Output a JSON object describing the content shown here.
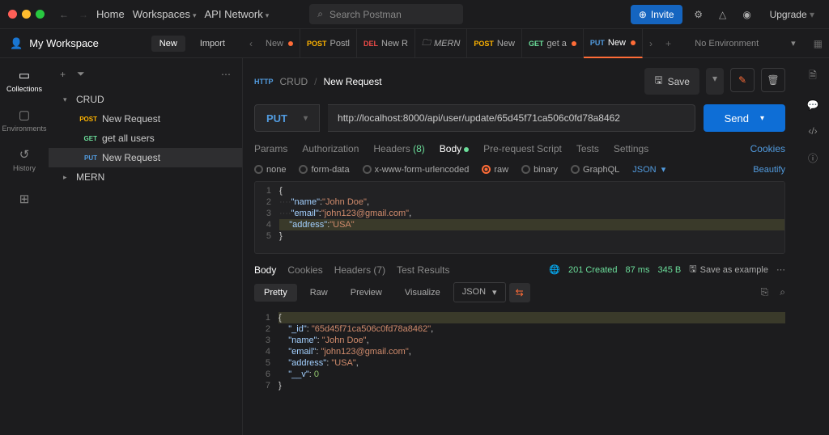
{
  "header": {
    "home": "Home",
    "workspaces": "Workspaces",
    "api_network": "API Network",
    "search_placeholder": "Search Postman",
    "invite": "Invite",
    "upgrade": "Upgrade"
  },
  "workspace": {
    "title": "My Workspace",
    "new": "New",
    "import": "Import"
  },
  "tabs": [
    {
      "method": "",
      "label": "New",
      "dirty": true,
      "kind": "new"
    },
    {
      "method": "POST",
      "label": "Postl",
      "dirty": false
    },
    {
      "method": "DEL",
      "label": "New R",
      "dirty": false
    },
    {
      "method": "",
      "label": "MERN",
      "dirty": false,
      "mern": true
    },
    {
      "method": "POST",
      "label": "New",
      "dirty": false
    },
    {
      "method": "GET",
      "label": "get a",
      "dirty": true
    },
    {
      "method": "PUT",
      "label": "New",
      "dirty": true,
      "active": true
    }
  ],
  "environment": "No Environment",
  "left_rail": [
    {
      "label": "Collections",
      "active": true
    },
    {
      "label": "Environments"
    },
    {
      "label": "History"
    }
  ],
  "tree": {
    "crud": "CRUD",
    "items": [
      {
        "method": "POST",
        "label": "New Request"
      },
      {
        "method": "GET",
        "label": "get all users"
      },
      {
        "method": "PUT",
        "label": "New Request",
        "sel": true
      }
    ],
    "mern": "MERN"
  },
  "breadcrumb": {
    "http": "HTTP",
    "folder": "CRUD",
    "current": "New Request",
    "save": "Save"
  },
  "request": {
    "method": "PUT",
    "url": "http://localhost:8000/api/user/update/65d45f71ca506c0fd78a8462",
    "send": "Send"
  },
  "req_tabs": {
    "params": "Params",
    "auth": "Authorization",
    "headers": "Headers",
    "headers_count": "(8)",
    "body": "Body",
    "prescript": "Pre-request Script",
    "tests": "Tests",
    "settings": "Settings",
    "cookies": "Cookies"
  },
  "body_types": {
    "none": "none",
    "form": "form-data",
    "url": "x-www-form-urlencoded",
    "raw": "raw",
    "binary": "binary",
    "graphql": "GraphQL",
    "json": "JSON",
    "beautify": "Beautify"
  },
  "req_body": {
    "l1": "{",
    "l2_k": "\"name\"",
    "l2_v": "\"John Doe\"",
    "l3_k": "\"email\"",
    "l3_v": "\"john123@gmail.com\"",
    "l4_k": "\"address\"",
    "l4_v": "\"USA\"",
    "l5": "}"
  },
  "resp_tabs": {
    "body": "Body",
    "cookies": "Cookies",
    "headers": "Headers",
    "hcnt": "(7)",
    "tests": "Test Results"
  },
  "resp_stats": {
    "status": "201 Created",
    "time": "87 ms",
    "size": "345 B",
    "save": "Save as example"
  },
  "resp_view": {
    "pretty": "Pretty",
    "raw": "Raw",
    "preview": "Preview",
    "visualize": "Visualize",
    "json": "JSON"
  },
  "resp_body": {
    "l1": "{",
    "l2_k": "\"_id\"",
    "l2_v": "\"65d45f71ca506c0fd78a8462\"",
    "l3_k": "\"name\"",
    "l3_v": "\"John Doe\"",
    "l4_k": "\"email\"",
    "l4_v": "\"john123@gmail.com\"",
    "l5_k": "\"address\"",
    "l5_v": "\"USA\"",
    "l6_k": "\"__v\"",
    "l6_v": "0",
    "l7": "}"
  }
}
